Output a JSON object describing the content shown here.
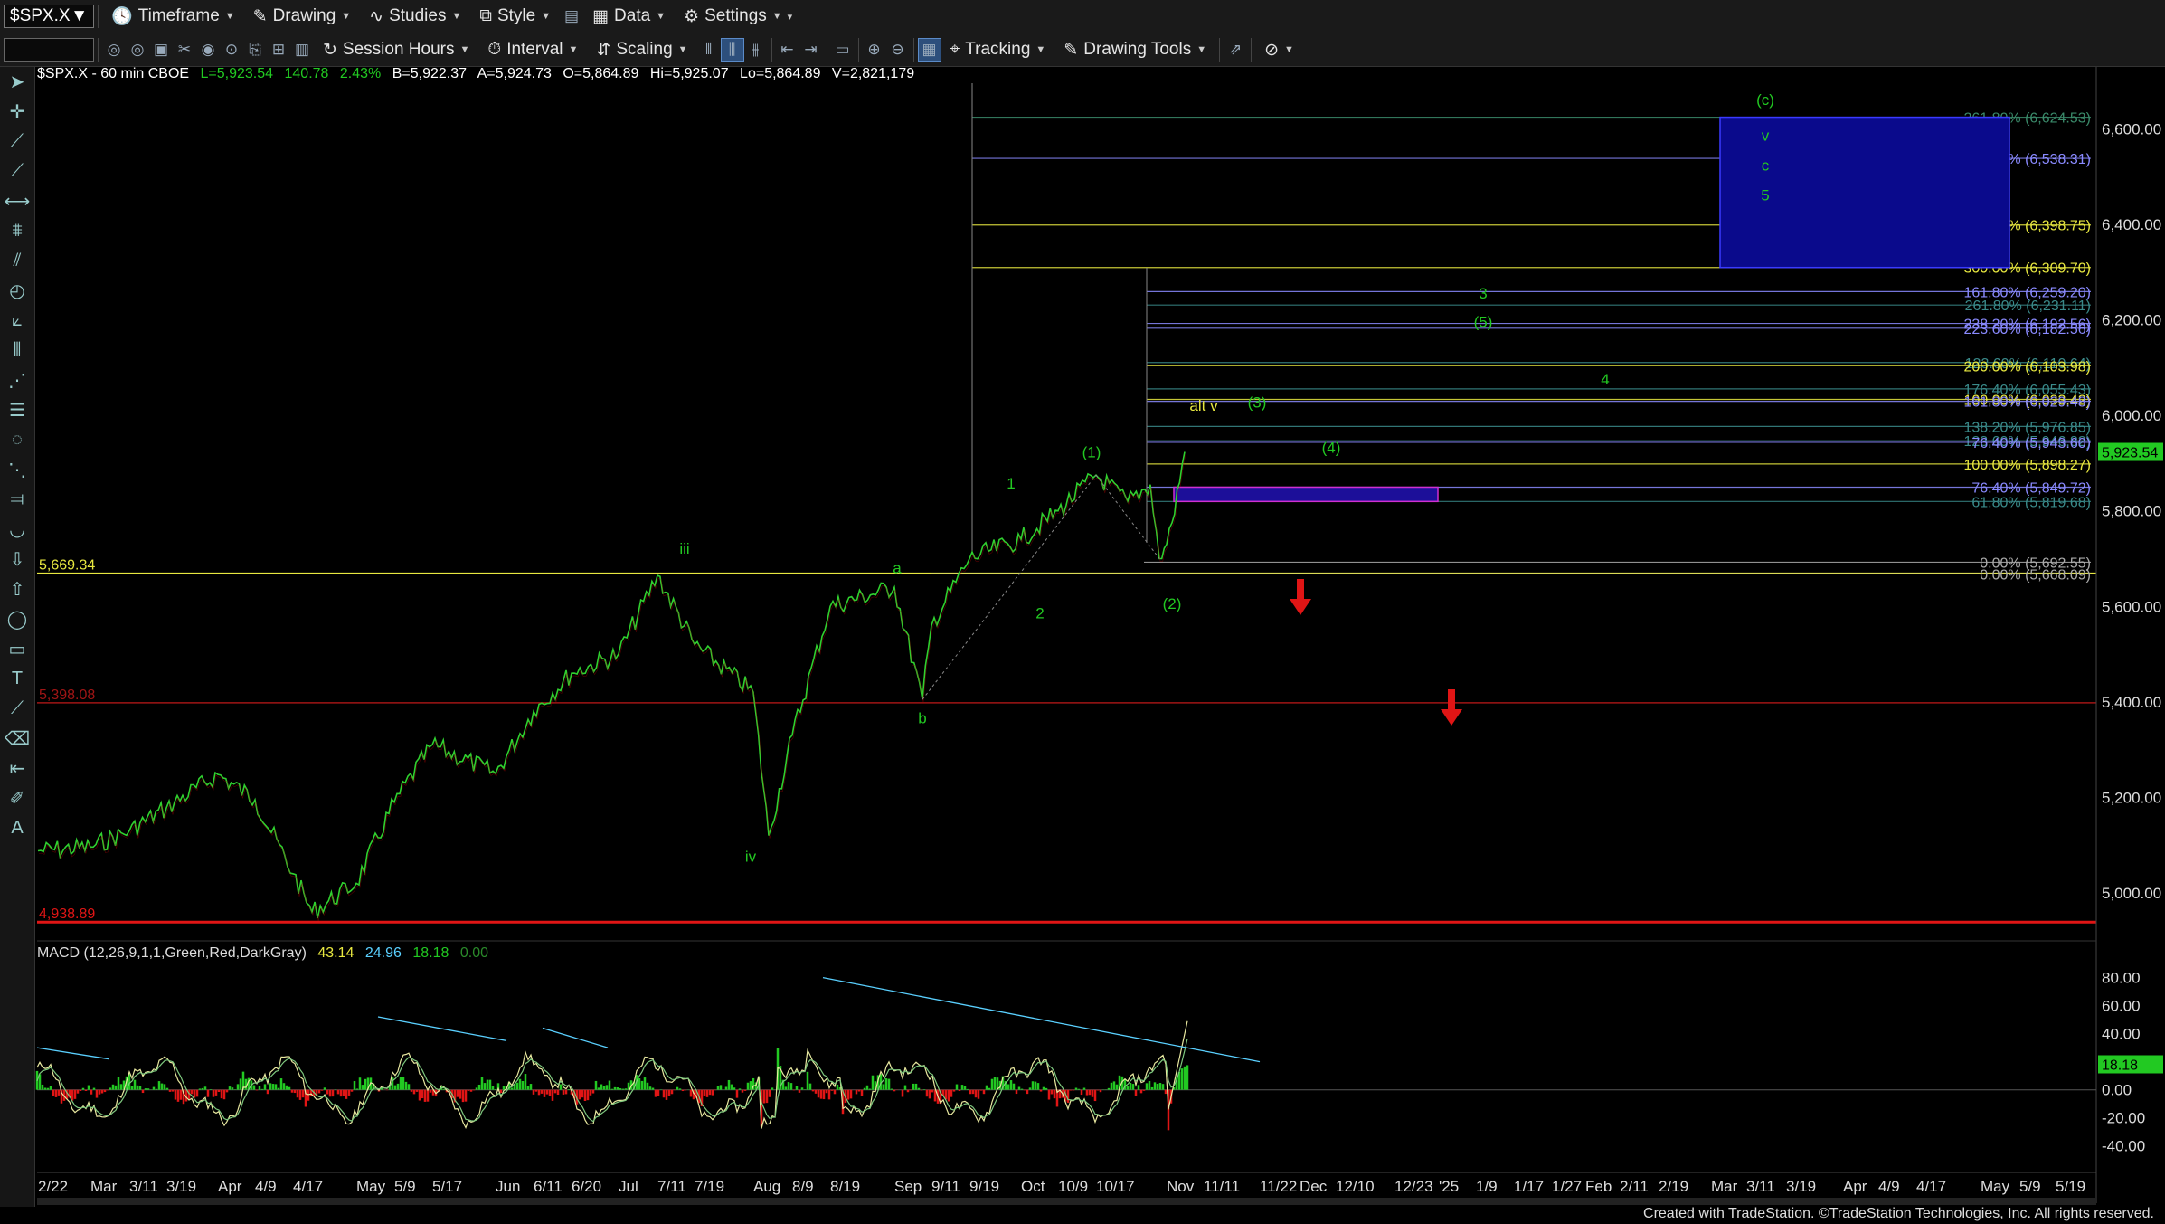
{
  "toolbar1": {
    "symbol": "$SPX.X",
    "items": [
      {
        "label": "Timeframe",
        "icon": "clock-icon"
      },
      {
        "label": "Drawing",
        "icon": "pencil-icon"
      },
      {
        "label": "Studies",
        "icon": "studies-icon"
      },
      {
        "label": "Style",
        "icon": "style-icon"
      },
      {
        "label": "Data",
        "icon": "data-icon"
      },
      {
        "label": "Settings",
        "icon": "gear-icon"
      }
    ]
  },
  "toolbar2": {
    "session_hours": "Session Hours",
    "interval": "Interval",
    "scaling": "Scaling",
    "tracking": "Tracking",
    "drawing_tools": "Drawing Tools"
  },
  "header": {
    "symbol_info": "$SPX.X - 60 min  CBOE",
    "last": "L=5,923.54",
    "change": "140.78",
    "pct": "2.43%",
    "bid": "B=5,922.37",
    "ask": "A=5,924.73",
    "open": "O=5,864.89",
    "high": "Hi=5,925.07",
    "low": "Lo=5,864.89",
    "volume": "V=2,821,179"
  },
  "macd_header": {
    "label": "MACD (12,26,9,1,1,Green,Red,DarkGray)",
    "v1": "43.14",
    "v2": "24.96",
    "v3": "18.18",
    "v4": "0.00"
  },
  "footer": "Created with TradeStation. ©TradeStation Technologies, Inc. All rights reserved.",
  "colors": {
    "green": "#22c922",
    "red": "#e01515",
    "fib_blue": "#8a8aff",
    "fib_yellow": "#e8e840",
    "fib_teal": "#3a8a8a",
    "box_blue": "#0a0a8c"
  },
  "chart_data": {
    "type": "line",
    "title": "$SPX.X - 60 min",
    "y_ticks": [
      "6,600.00",
      "6,400.00",
      "6,200.00",
      "6,000.00",
      "5,800.00",
      "5,600.00",
      "5,400.00",
      "5,200.00",
      "5,000.00"
    ],
    "y_tick_values": [
      6600,
      6400,
      6200,
      6000,
      5800,
      5600,
      5400,
      5200,
      5000
    ],
    "ylim": [
      4890,
      6690
    ],
    "x_ticks": [
      "2/22",
      "Mar",
      "3/11",
      "3/19",
      "Apr",
      "4/9",
      "4/17",
      "May",
      "5/9",
      "5/17",
      "Jun",
      "6/11",
      "6/20",
      "Jul",
      "7/11",
      "7/19",
      "Aug",
      "8/9",
      "8/19",
      "Sep",
      "9/11",
      "9/19",
      "Oct",
      "10/9",
      "10/17",
      "Nov",
      "11/11",
      "11/22",
      "Dec",
      "12/10",
      "12/23",
      "'25",
      "1/9",
      "1/17",
      "1/27",
      "Feb",
      "2/11",
      "2/19",
      "Mar",
      "3/11",
      "3/19",
      "Apr",
      "4/9",
      "4/17",
      "May",
      "5/9",
      "5/19"
    ],
    "last_price_label": "5,923.54",
    "price_path": [
      {
        "date": "2/22",
        "value": 5088
      },
      {
        "date": "Mar",
        "value": 5096
      },
      {
        "date": "3/11",
        "value": 5130
      },
      {
        "date": "3/19",
        "value": 5178
      },
      {
        "date": "Apr",
        "value": 5248
      },
      {
        "date": "4/9",
        "value": 5195
      },
      {
        "date": "4/17",
        "value": 5040
      },
      {
        "date": "4/19",
        "value": 4960
      },
      {
        "date": "May",
        "value": 5020
      },
      {
        "date": "5/9",
        "value": 5190
      },
      {
        "date": "5/17",
        "value": 5310
      },
      {
        "date": "Jun",
        "value": 5250
      },
      {
        "date": "6/11",
        "value": 5380
      },
      {
        "date": "6/20",
        "value": 5460
      },
      {
        "date": "Jul",
        "value": 5500
      },
      {
        "date": "7/11",
        "value": 5665
      },
      {
        "date": "7/19",
        "value": 5520
      },
      {
        "date": "Aug",
        "value": 5420
      },
      {
        "date": "8/5",
        "value": 5120
      },
      {
        "date": "8/9",
        "value": 5330
      },
      {
        "date": "8/19",
        "value": 5600
      },
      {
        "date": "Sep",
        "value": 5640
      },
      {
        "date": "9/6",
        "value": 5405
      },
      {
        "date": "9/11",
        "value": 5560
      },
      {
        "date": "9/19",
        "value": 5700
      },
      {
        "date": "Oct",
        "value": 5740
      },
      {
        "date": "10/9",
        "value": 5800
      },
      {
        "date": "10/17",
        "value": 5875
      },
      {
        "date": "10/24",
        "value": 5820
      },
      {
        "date": "10/29",
        "value": 5855
      },
      {
        "date": "10/31",
        "value": 5700
      },
      {
        "date": "Nov",
        "value": 5730
      },
      {
        "date": "11/4",
        "value": 5775
      },
      {
        "date": "11/6",
        "value": 5923.54
      }
    ],
    "horizontal_levels": [
      {
        "label": "5,669.34",
        "value": 5669.34,
        "color": "#e8e840"
      },
      {
        "label": "5,398.08",
        "value": 5398.08,
        "color": "#a01515"
      },
      {
        "label": "4,938.89",
        "value": 4938.89,
        "color": "#e01515"
      }
    ],
    "fib_levels": [
      {
        "label": "261.80% (6,624.53)",
        "value": 6624.53,
        "color": "#3a8a6a"
      },
      {
        "label": "238.20% (6,538.31)",
        "value": 6538.31,
        "color": "#8a8aff"
      },
      {
        "label": "200.00% (6,398.75)",
        "value": 6398.75,
        "color": "#e8e840"
      },
      {
        "label": "300.00% (6,309.70)",
        "value": 6309.7,
        "color": "#e8e840"
      },
      {
        "label": "161.80% (6,259.20)",
        "value": 6259.2,
        "color": "#8a8aff"
      },
      {
        "label": "261.80% (6,231.11)",
        "value": 6231.11,
        "color": "#3a8a8a"
      },
      {
        "label": "238.20% (6,192.56)",
        "value": 6192.56,
        "color": "#8a8aff"
      },
      {
        "label": "223.60% (6,182.56)",
        "value": 6182.56,
        "color": "#8a8aff"
      },
      {
        "label": "123.60% (6,110.64)",
        "value": 6110.64,
        "color": "#3a8a8a"
      },
      {
        "label": "200.00% (6,103.98)",
        "value": 6103.98,
        "color": "#e8e840"
      },
      {
        "label": "176.40% (6,055.43)",
        "value": 6055.43,
        "color": "#3a8a8a"
      },
      {
        "label": "100.00% (6,033.42)",
        "value": 6033.42,
        "color": "#e8e840"
      },
      {
        "label": "161.80% (6,029.48)",
        "value": 6029.48,
        "color": "#8a8aff"
      },
      {
        "label": "138.20% (5,976.85)",
        "value": 5976.85,
        "color": "#3a8a8a"
      },
      {
        "label": "123.60% (5,946.82)",
        "value": 5946.82,
        "color": "#3a8a8a"
      },
      {
        "label": "76.40% (5,943.60)",
        "value": 5943.6,
        "color": "#8a8aff"
      },
      {
        "label": "100.00% (5,898.27)",
        "value": 5898.27,
        "color": "#e8e840"
      },
      {
        "label": "76.40% (5,849.72)",
        "value": 5849.72,
        "color": "#8a8aff"
      },
      {
        "label": "61.80% (5,819.68)",
        "value": 5819.68,
        "color": "#3a8a8a"
      },
      {
        "label": "0.00% (5,692.55)",
        "value": 5692.55,
        "color": "#aaaaaa"
      },
      {
        "label": "0.00% (5,668.09)",
        "value": 5668.09,
        "color": "#aaaaaa"
      }
    ],
    "wave_labels": [
      {
        "text": "(c)",
        "date": "3/8",
        "value": 6650,
        "color": "#22c922"
      },
      {
        "text": "v",
        "date": "3/8",
        "value": 6575,
        "color": "#22c922"
      },
      {
        "text": "c",
        "date": "3/8",
        "value": 6513,
        "color": "#22c922"
      },
      {
        "text": "5",
        "date": "3/8",
        "value": 6450,
        "color": "#22c922"
      },
      {
        "text": "3",
        "date": "1/1",
        "value": 6245,
        "color": "#22c922"
      },
      {
        "text": "(5)",
        "date": "1/1",
        "value": 6185,
        "color": "#22c922"
      },
      {
        "text": "4",
        "date": "1/24",
        "value": 6065,
        "color": "#22c922"
      },
      {
        "text": "alt v",
        "date": "11/11",
        "value": 6010,
        "color": "#e8e840"
      },
      {
        "text": "(3)",
        "date": "11/17",
        "value": 6016,
        "color": "#22c922"
      },
      {
        "text": "(4)",
        "date": "11/27",
        "value": 5922,
        "color": "#22c922"
      },
      {
        "text": "(1)",
        "date": "10/15",
        "value": 5912,
        "color": "#22c922"
      },
      {
        "text": "1",
        "date": "9/27",
        "value": 5847,
        "color": "#22c922"
      },
      {
        "text": "iii",
        "date": "7/15",
        "value": 5710,
        "color": "#22c922"
      },
      {
        "text": "a",
        "date": "8/25",
        "value": 5670,
        "color": "#22c922"
      },
      {
        "text": "2",
        "date": "10/7",
        "value": 5575,
        "color": "#22c922"
      },
      {
        "text": "(2)",
        "date": "11/4",
        "value": 5595,
        "color": "#22c922"
      },
      {
        "text": "b",
        "date": "9/10",
        "value": 5355,
        "color": "#22c922"
      },
      {
        "text": "iv",
        "date": "8/3",
        "value": 5065,
        "color": "#22c922"
      }
    ],
    "macd": {
      "label": "MACD (12,26,9,1,1,Green,Red,DarkGray)",
      "values": [
        43.14,
        24.96,
        18.18,
        0.0
      ],
      "last_label": "18.18",
      "y_ticks": [
        "80.00",
        "60.00",
        "40.00",
        "20.00",
        "0.00",
        "-20.00",
        "-40.00"
      ],
      "y_tick_values": [
        80,
        60,
        40,
        20,
        0,
        -20,
        -40
      ],
      "ylim": [
        -55,
        92
      ]
    },
    "grid": false
  }
}
